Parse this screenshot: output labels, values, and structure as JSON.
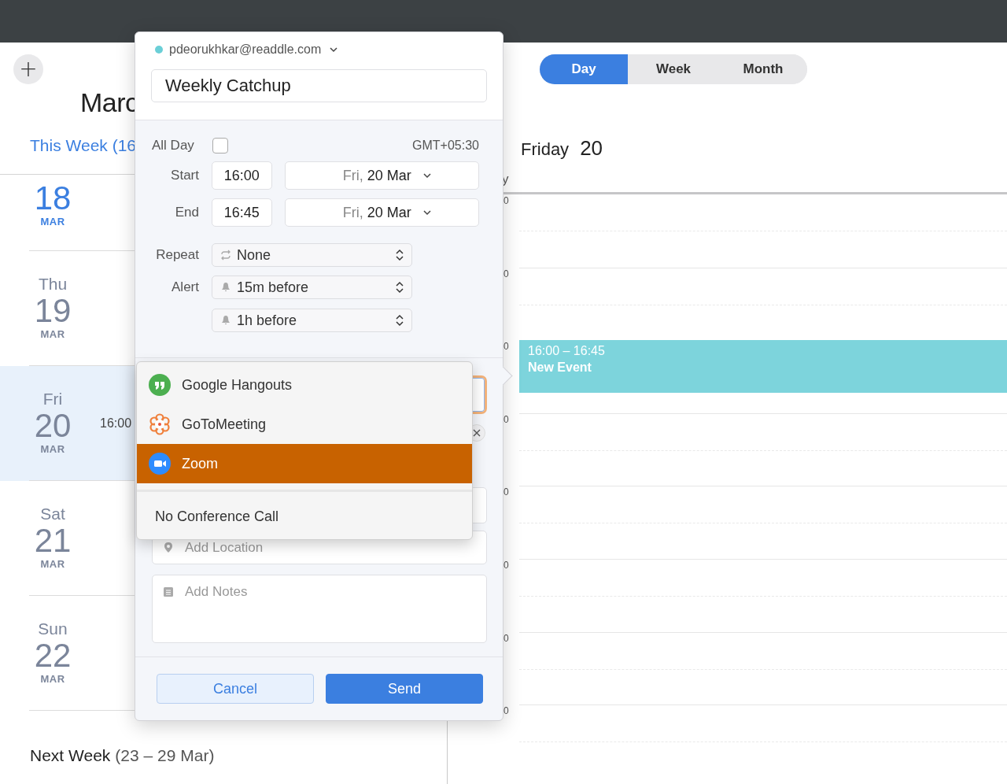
{
  "new_button": {
    "label": "+"
  },
  "sidebar": {
    "month_title": "Marc",
    "this_week": "This Week (16",
    "days": [
      {
        "day": "18",
        "month": "MAR",
        "today": true,
        "selected": false
      },
      {
        "weekday": "Thu",
        "day": "19",
        "month": "MAR",
        "today": false,
        "selected": false
      },
      {
        "weekday": "Fri",
        "day": "20",
        "month": "MAR",
        "today": false,
        "selected": true,
        "event_time": "16:00"
      },
      {
        "weekday": "Sat",
        "day": "21",
        "month": "MAR",
        "today": false,
        "selected": false
      },
      {
        "weekday": "Sun",
        "day": "22",
        "month": "MAR",
        "today": false,
        "selected": false
      }
    ],
    "next_week": {
      "label": "Next Week",
      "range": "(23 – 29 Mar)"
    }
  },
  "view_switcher": [
    {
      "label": "Day",
      "selected": true
    },
    {
      "label": "Week",
      "selected": false
    },
    {
      "label": "Month",
      "selected": false
    }
  ],
  "day_header": {
    "weekday": "Friday",
    "day": "20"
  },
  "timeline": {
    "all_day_fragment": "y",
    "hour_labels": [
      "0",
      "0",
      "0",
      "0",
      "0",
      "0",
      "0",
      "0"
    ],
    "event": {
      "time": "16:00 – 16:45",
      "title": "New Event"
    }
  },
  "popup": {
    "account": {
      "email": "pdeorukhkar@readdle.com"
    },
    "title": "Weekly Catchup",
    "all_day": {
      "label": "All Day",
      "checked": false
    },
    "timezone": "GMT+05:30",
    "start": {
      "label": "Start",
      "time": "16:00",
      "weekday": "Fri,",
      "date": "20 Mar"
    },
    "end": {
      "label": "End",
      "time": "16:45",
      "weekday": "Fri,",
      "date": "20 Mar"
    },
    "repeat": {
      "label": "Repeat",
      "value": "None"
    },
    "alert": {
      "label": "Alert",
      "values": [
        "15m before",
        "1h before"
      ]
    },
    "location": {
      "placeholder": "Add Location"
    },
    "notes": {
      "placeholder": "Add Notes"
    },
    "buttons": [
      {
        "label": "Cancel",
        "kind": "secondary"
      },
      {
        "label": "Send",
        "kind": "primary"
      }
    ]
  },
  "conference_menu": {
    "items": [
      {
        "label": "Google Hangouts",
        "kind": "hangouts",
        "selected": false
      },
      {
        "label": "GoToMeeting",
        "kind": "gotomeeting",
        "selected": false
      },
      {
        "label": "Zoom",
        "kind": "zoom",
        "selected": true
      }
    ],
    "no_call": "No Conference Call"
  }
}
